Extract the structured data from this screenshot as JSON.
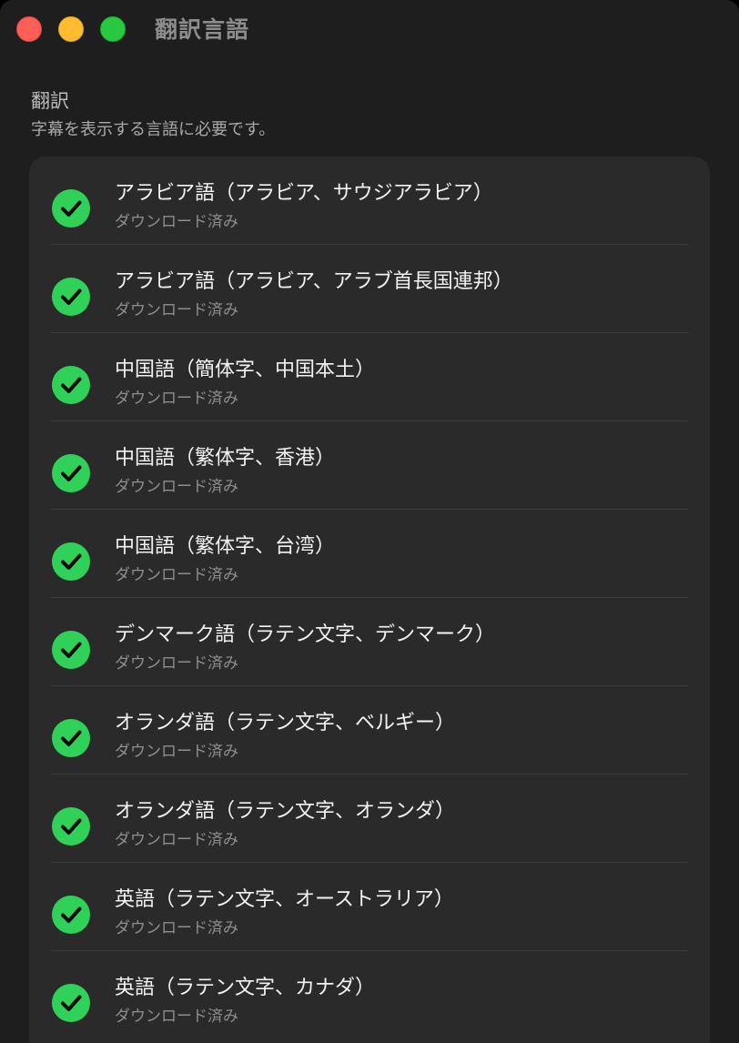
{
  "window": {
    "title": "翻訳言語"
  },
  "section": {
    "heading": "翻訳",
    "subtitle": "字幕を表示する言語に必要です。"
  },
  "languages": [
    {
      "name": "アラビア語（アラビア、サウジアラビア）",
      "status": "ダウンロード済み"
    },
    {
      "name": "アラビア語（アラビア、アラブ首長国連邦）",
      "status": "ダウンロード済み"
    },
    {
      "name": "中国語（簡体字、中国本土）",
      "status": "ダウンロード済み"
    },
    {
      "name": "中国語（繁体字、香港）",
      "status": "ダウンロード済み"
    },
    {
      "name": "中国語（繁体字、台湾）",
      "status": "ダウンロード済み"
    },
    {
      "name": "デンマーク語（ラテン文字、デンマーク）",
      "status": "ダウンロード済み"
    },
    {
      "name": "オランダ語（ラテン文字、ベルギー）",
      "status": "ダウンロード済み"
    },
    {
      "name": "オランダ語（ラテン文字、オランダ）",
      "status": "ダウンロード済み"
    },
    {
      "name": "英語（ラテン文字、オーストラリア）",
      "status": "ダウンロード済み"
    },
    {
      "name": "英語（ラテン文字、カナダ）",
      "status": "ダウンロード済み"
    }
  ],
  "icons": {
    "downloaded": "checkmark-circle-icon"
  },
  "colors": {
    "window_background": "#1e1e1e",
    "panel_background": "#2a2a2a",
    "check_green": "#30d158",
    "traffic_close": "#ff5f57",
    "traffic_minimize": "#febc2e",
    "traffic_zoom": "#28c840"
  }
}
